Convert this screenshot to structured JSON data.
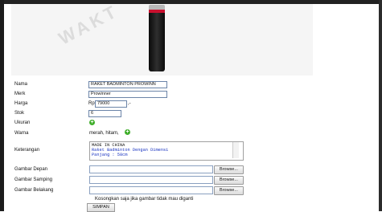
{
  "product_image": {
    "watermark_text": "WAKT",
    "icon": "badminton-racket-handle"
  },
  "form": {
    "nama": {
      "label": "Nama",
      "value": "RAKET BADMINTON PROWINN"
    },
    "merk": {
      "label": "Merk",
      "value": "Prowinner"
    },
    "harga": {
      "label": "Harga",
      "prefix": "Rp",
      "value": "79000",
      "suffix": ",-"
    },
    "stok": {
      "label": "Stok",
      "value": "6"
    },
    "ukuran": {
      "label": "Ukuran"
    },
    "warna": {
      "label": "Warna",
      "value": "merah, hitam,"
    },
    "keterangan": {
      "label": "Keterangan",
      "line1": "MADE IN CHINA",
      "line2": "Raket Badminton Dengan Dimensi",
      "line3": "Panjang : 58cm"
    },
    "gambar_depan": {
      "label": "Gambar Depan",
      "browse_label": "Browse..."
    },
    "gambar_samping": {
      "label": "Gambar Samping",
      "browse_label": "Browse..."
    },
    "gambar_belakang": {
      "label": "Gambar Belakang",
      "browse_label": "Browse..."
    },
    "hint": "Kosongkan saja jika gambar tidak mau diganti",
    "submit_label": "SIMPAN"
  },
  "colors": {
    "add_button": "#3fae2a",
    "textarea_link": "#1a34c0",
    "racket_band": "#c8102e"
  }
}
